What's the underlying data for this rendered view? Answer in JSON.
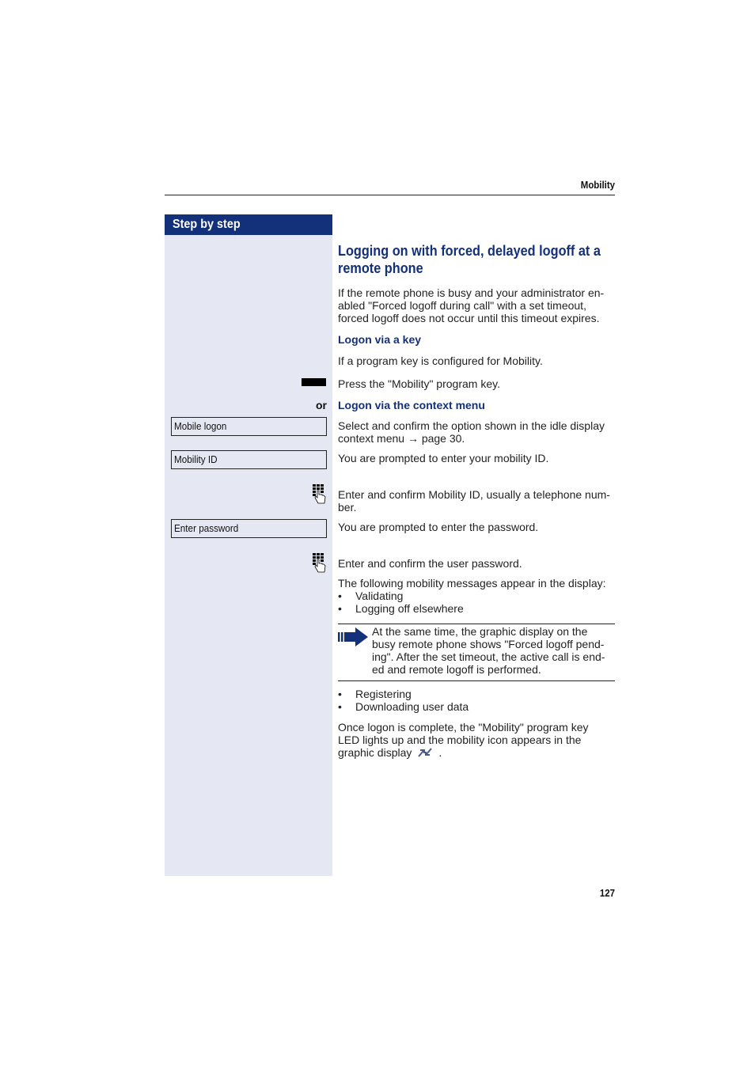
{
  "header": {
    "section_title": "Mobility"
  },
  "sidebar": {
    "heading": "Step by step"
  },
  "main": {
    "title": "Logging on with forced, delayed logoff at a remote phone",
    "intro": "If the remote phone is busy and your administrator en-abled \"Forced logoff during call\" with a set timeout, forced logoff does not occur until this timeout expires.",
    "intro_lines": [
      "If the remote phone is busy and your administrator en-",
      "abled \"Forced logoff during call\" with a set timeout,",
      "forced logoff does not occur until this timeout expires."
    ],
    "logon_key_heading": "Logon via a key",
    "logon_key_condition": "If a program key is configured for Mobility.",
    "press_key_text": "Press the \"Mobility\" program key.",
    "or_label": "or",
    "context_menu_heading": "Logon via the context menu",
    "context_menu_lines": [
      "Select and confirm the option shown in the idle display",
      "context menu → page 30."
    ],
    "prompt_mobility_id": "You are prompted to enter your mobility ID.",
    "enter_id_lines": [
      "Enter and confirm Mobility ID, usually a telephone num-",
      "ber."
    ],
    "prompt_password": "You are prompted to enter the password.",
    "enter_password": "Enter and confirm the user password.",
    "messages_intro": "The following mobility messages appear in the display:",
    "messages_1": [
      "Validating",
      "Logging off elsewhere"
    ],
    "note_lines": [
      "At the same time, the graphic display on the",
      "busy remote phone shows \"Forced logoff pend-",
      "ing\". After the set timeout, the active call is end-",
      "ed and remote logoff is performed."
    ],
    "messages_2": [
      "Registering",
      "Downloading user data"
    ],
    "completion_lines": [
      "Once logon is complete, the \"Mobility\" program key",
      "LED lights up and the mobility icon appears in the"
    ],
    "completion_last_prefix": "graphic display",
    "completion_last_suffix": "."
  },
  "displays": {
    "mobile_logon": "Mobile logon",
    "mobility_id": "Mobility ID",
    "enter_password": "Enter password"
  },
  "icons": {
    "program_key": "program-key-icon",
    "keypad": "keypad-icon",
    "note": "note-arrow-icon",
    "mobility": "mobility-icon"
  },
  "colors": {
    "accent": "#13307a",
    "sidebar_bg": "#e5e8f2"
  },
  "footer": {
    "page_number": "127"
  }
}
